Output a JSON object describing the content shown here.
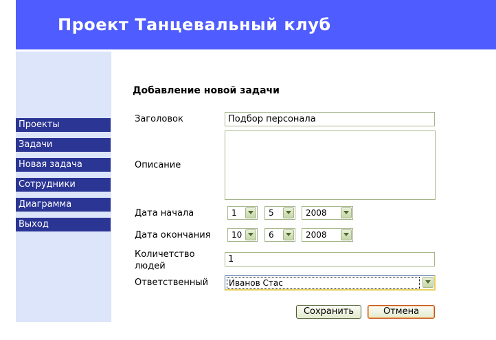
{
  "header": {
    "title": "Проект Танцевальный клуб"
  },
  "sidebar": {
    "items": [
      {
        "label": "Проекты"
      },
      {
        "label": "Задачи"
      },
      {
        "label": "Новая задача"
      },
      {
        "label": "Сотрудники"
      },
      {
        "label": "Диаграмма"
      },
      {
        "label": "Выход"
      }
    ]
  },
  "form": {
    "title": "Добавление новой задачи",
    "title_field": {
      "label": "Заголовок",
      "value": "Подбор персонала"
    },
    "description": {
      "label": "Описание",
      "value": ""
    },
    "start_date": {
      "label": "Дата начала",
      "day": "1",
      "month": "5",
      "year": "2008"
    },
    "end_date": {
      "label": "Дата окончания",
      "day": "10",
      "month": "6",
      "year": "2008"
    },
    "people_count": {
      "label": "Количетство людей",
      "value": "1"
    },
    "responsible": {
      "label": "Ответственный",
      "value": "Иванов Стас"
    },
    "save_label": "Сохранить",
    "cancel_label": "Отмена"
  },
  "colors": {
    "header_bg": "#4f5cff",
    "sidebar_bg": "#dde5fb",
    "nav_item_bg": "#2b3594",
    "field_border": "#a5b48a"
  }
}
